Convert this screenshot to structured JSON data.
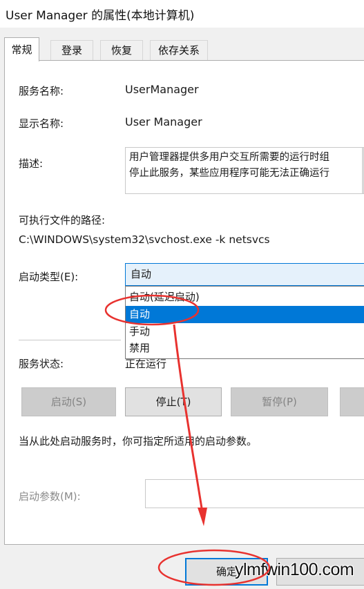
{
  "window": {
    "title": "User Manager 的属性(本地计算机)"
  },
  "tabs": [
    {
      "label": "常规",
      "active": true
    },
    {
      "label": "登录",
      "active": false
    },
    {
      "label": "恢复",
      "active": false
    },
    {
      "label": "依存关系",
      "active": false
    }
  ],
  "general": {
    "service_name_label": "服务名称:",
    "service_name": "UserManager",
    "display_name_label": "显示名称:",
    "display_name": "User Manager",
    "description_label": "描述:",
    "description_line1": "用户管理器提供多用户交互所需要的运行时组",
    "description_line2": "停止此服务，某些应用程序可能无法正确运行",
    "exe_path_label": "可执行文件的路径:",
    "exe_path": "C:\\WINDOWS\\system32\\svchost.exe -k netsvcs",
    "startup_type_label": "启动类型(E):",
    "startup_type_value": "自动",
    "startup_options": [
      "自动(延迟启动)",
      "自动",
      "手动",
      "禁用"
    ],
    "startup_selected_index": 1,
    "service_status_label": "服务状态:",
    "service_status": "正在运行",
    "buttons": {
      "start": "启动(S)",
      "stop": "停止(T)",
      "pause": "暂停(P)"
    },
    "hint": "当从此处启动服务时，你可指定所适用的启动参数。",
    "start_params_label": "启动参数(M):",
    "start_params_value": ""
  },
  "footer": {
    "ok_label": "确定",
    "watermark": "ylmfwin100.com"
  },
  "colors": {
    "accent": "#0078d7",
    "annotation": "#e8322f"
  }
}
